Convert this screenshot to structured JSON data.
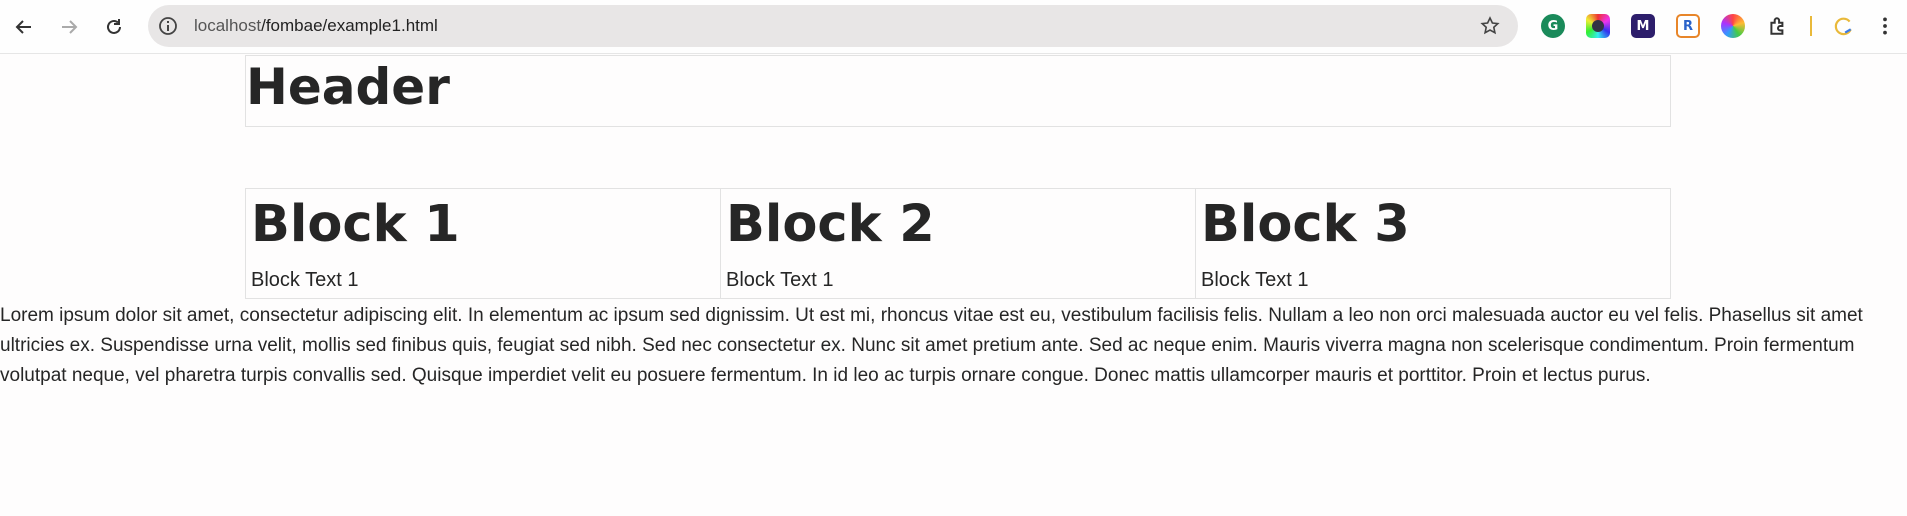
{
  "browser": {
    "url_host": "localhost",
    "url_path": "/fombae/example1.html",
    "icons": [
      "back-icon",
      "forward-icon",
      "reload-icon",
      "site-info-icon",
      "bookmark-star-icon",
      "extensions-icon",
      "menu-icon"
    ],
    "extensions": [
      "grammarly",
      "colorzilla",
      "ext-m",
      "ext-r",
      "color-wheel"
    ]
  },
  "page": {
    "header": "Header",
    "blocks": [
      {
        "title": "Block 1",
        "text": "Block Text 1"
      },
      {
        "title": "Block 2",
        "text": "Block Text 1"
      },
      {
        "title": "Block 3",
        "text": "Block Text 1"
      }
    ],
    "paragraph": "Lorem ipsum dolor sit amet, consectetur adipiscing elit. In elementum ac ipsum sed dignissim. Ut est mi, rhoncus vitae est eu, vestibulum facilisis felis. Nullam a leo non orci malesuada auctor eu vel felis. Phasellus sit amet ultricies ex. Suspendisse urna velit, mollis sed finibus quis, feugiat sed nibh. Sed nec consectetur ex. Nunc sit amet pretium ante. Sed ac neque enim. Mauris viverra magna non scelerisque condimentum. Proin fermentum volutpat neque, vel pharetra turpis convallis sed. Quisque imperdiet velit eu posuere fermentum. In id leo ac turpis ornare congue. Donec mattis ullamcorper mauris et porttitor. Proin et lectus purus."
  }
}
